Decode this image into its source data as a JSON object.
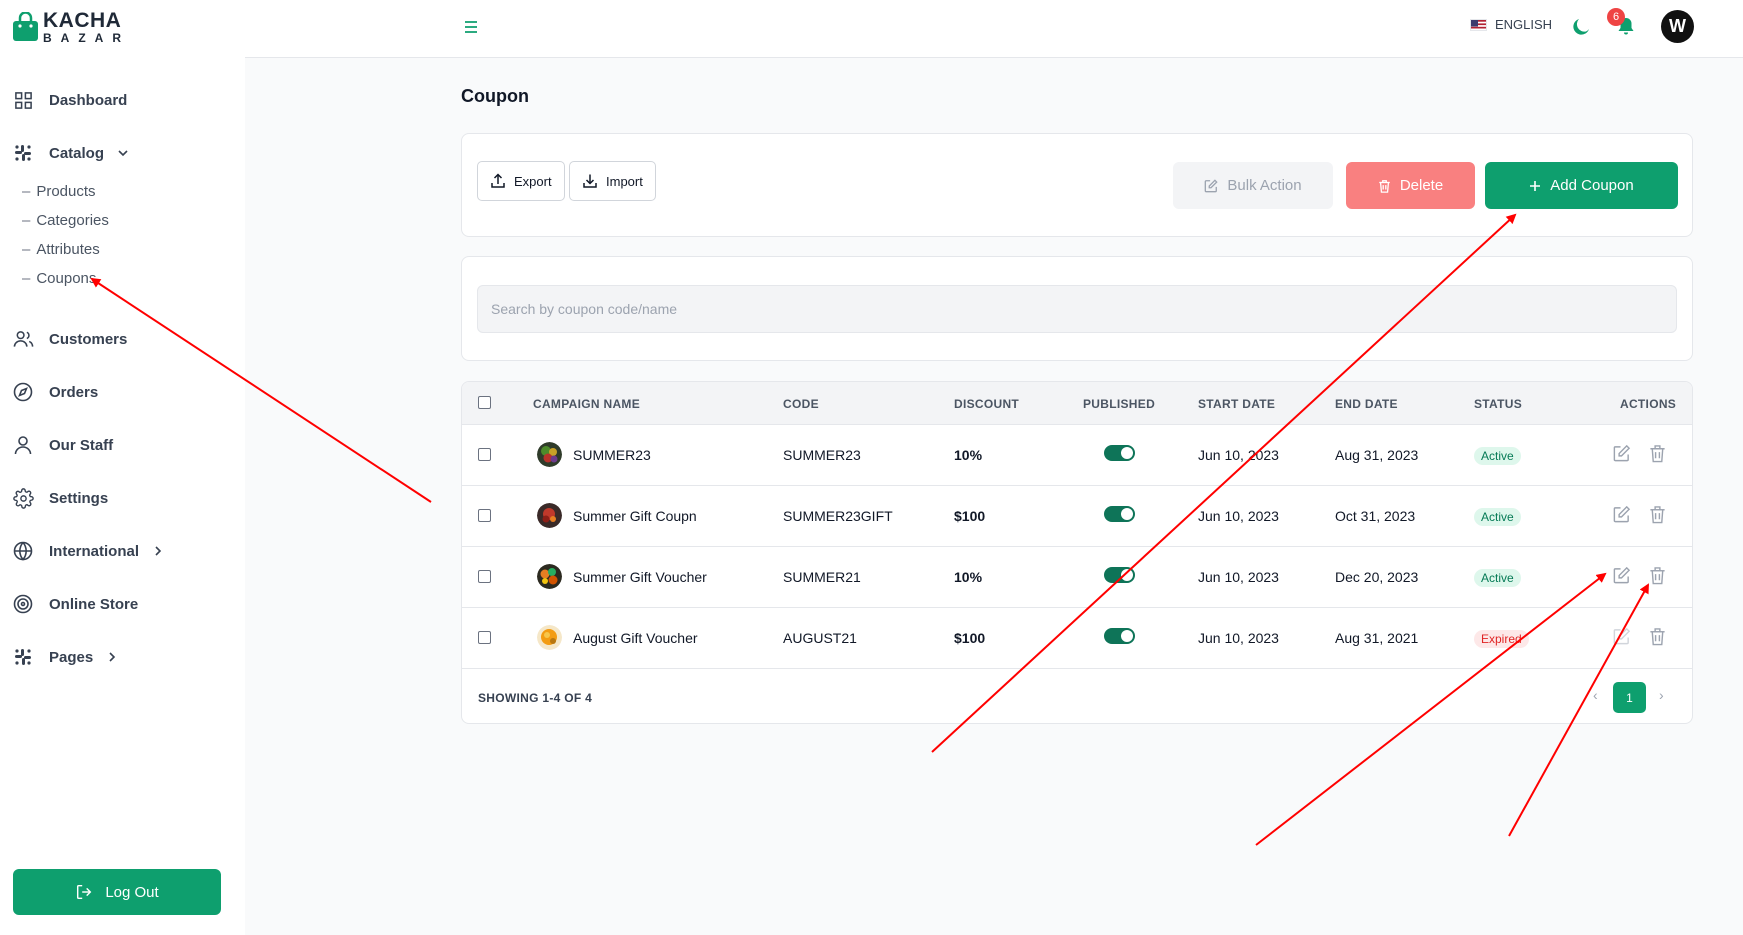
{
  "brand": {
    "line1": "KACHA",
    "line2": "BAZAR"
  },
  "sidebar": {
    "items": [
      {
        "label": "Dashboard",
        "icon": "grid-icon"
      },
      {
        "label": "Catalog",
        "icon": "slack-icon"
      },
      {
        "label": "Customers",
        "icon": "users-icon"
      },
      {
        "label": "Orders",
        "icon": "compass-icon"
      },
      {
        "label": "Our Staff",
        "icon": "user-icon"
      },
      {
        "label": "Settings",
        "icon": "gear-icon"
      },
      {
        "label": "International",
        "icon": "globe-icon"
      },
      {
        "label": "Online Store",
        "icon": "target-icon"
      },
      {
        "label": "Pages",
        "icon": "slack-icon"
      }
    ],
    "catalog_sub": [
      "Products",
      "Categories",
      "Attributes",
      "Coupons"
    ],
    "logout_label": "Log Out"
  },
  "header": {
    "language": "ENGLISH",
    "notifications_count": "6",
    "avatar_initial": "W"
  },
  "page": {
    "title": "Coupon"
  },
  "toolbar": {
    "export_label": "Export",
    "import_label": "Import",
    "bulk_label": "Bulk Action",
    "delete_label": "Delete",
    "add_label": "Add Coupon"
  },
  "search": {
    "placeholder": "Search by coupon code/name"
  },
  "table": {
    "headers": [
      "CAMPAIGN NAME",
      "CODE",
      "DISCOUNT",
      "PUBLISHED",
      "START DATE",
      "END DATE",
      "STATUS",
      "ACTIONS"
    ],
    "rows": [
      {
        "name": "SUMMER23",
        "code": "SUMMER23",
        "discount": "10%",
        "published": true,
        "start": "Jun 10, 2023",
        "end": "Aug 31, 2023",
        "status": "Active"
      },
      {
        "name": "Summer Gift Coupn",
        "code": "SUMMER23GIFT",
        "discount": "$100",
        "published": true,
        "start": "Jun 10, 2023",
        "end": "Oct 31, 2023",
        "status": "Active"
      },
      {
        "name": "Summer Gift Voucher",
        "code": "SUMMER21",
        "discount": "10%",
        "published": true,
        "start": "Jun 10, 2023",
        "end": "Dec 20, 2023",
        "status": "Active"
      },
      {
        "name": "August Gift Voucher",
        "code": "AUGUST21",
        "discount": "$100",
        "published": true,
        "start": "Jun 10, 2023",
        "end": "Aug 31, 2021",
        "status": "Expired"
      }
    ],
    "showing": "SHOWING 1-4 OF 4",
    "current_page": "1"
  },
  "colors": {
    "primary": "#0e9f6e",
    "danger": "#f98080",
    "annotation": "#ff0000"
  }
}
